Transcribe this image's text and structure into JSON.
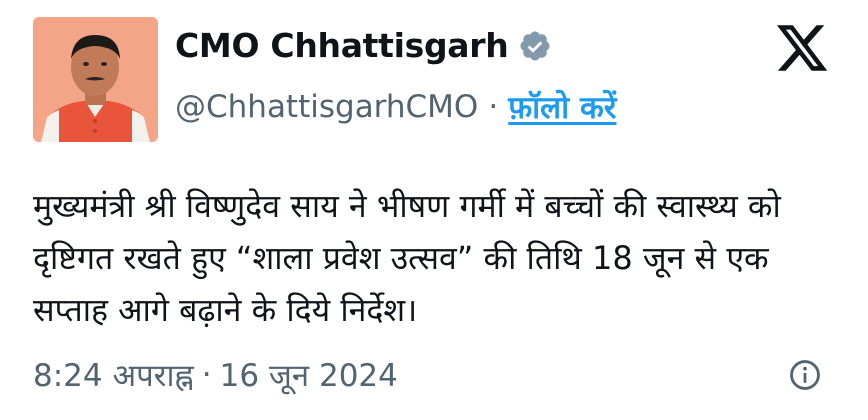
{
  "author": {
    "display_name": "CMO Chhattisgarh",
    "handle": "@ChhattisgarhCMO",
    "separator": "·",
    "follow_label": "फ़ॉलो करें",
    "verified_icon": "verified-badge-icon",
    "verified_color": "#829aab"
  },
  "tweet": {
    "text": "मुख्यमंत्री श्री विष्णुदेव साय ने भीषण गर्मी में बच्चों की स्वास्थ्य को दृष्टिगत रखते हुए “शाला प्रवेश उत्सव” की तिथि 18 जून से एक सप्ताह आगे बढ़ाने के दिये निर्देश।"
  },
  "meta": {
    "time": "8:24 अपराह्न",
    "separator": "·",
    "date": "16 जून 2024"
  },
  "icons": {
    "logo": "x-logo-icon",
    "info": "info-icon"
  },
  "colors": {
    "link": "#1d9bf0",
    "secondary_text": "#536471",
    "primary_text": "#0f1419"
  }
}
